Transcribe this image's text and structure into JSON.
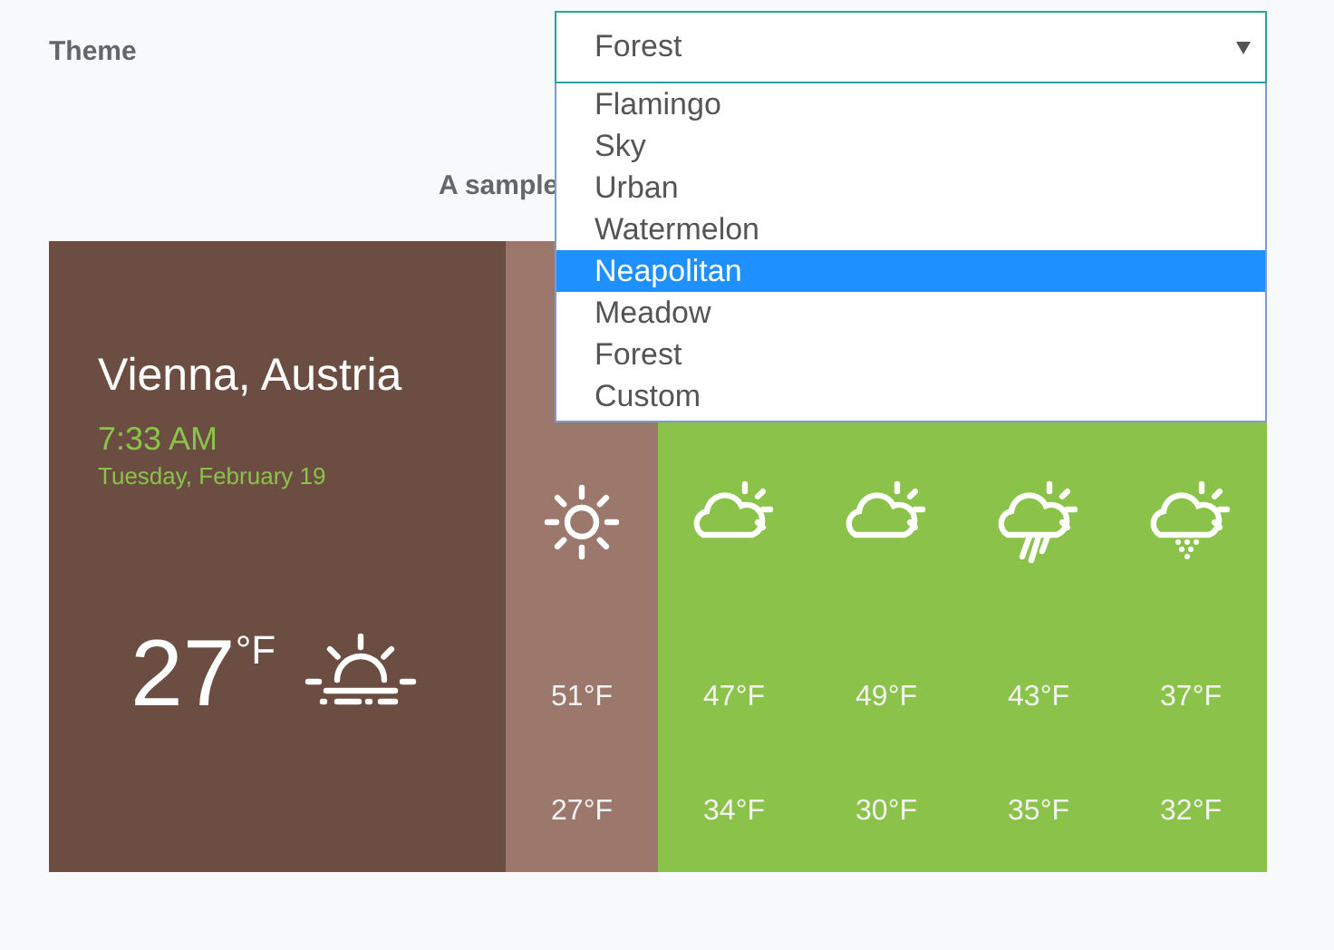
{
  "theme": {
    "label": "Theme",
    "value": "Forest",
    "expanded": true,
    "options": [
      {
        "label": "Flamingo",
        "highlighted": false
      },
      {
        "label": "Sky",
        "highlighted": false
      },
      {
        "label": "Urban",
        "highlighted": false
      },
      {
        "label": "Watermelon",
        "highlighted": false
      },
      {
        "label": "Neapolitan",
        "highlighted": true
      },
      {
        "label": "Meadow",
        "highlighted": false
      },
      {
        "label": "Forest",
        "highlighted": false
      },
      {
        "label": "Custom",
        "highlighted": false
      }
    ]
  },
  "caption": "A sample",
  "widget": {
    "city": "Vienna, Austria",
    "time": "7:33 AM",
    "date": "Tuesday, February 19",
    "temperature": "27",
    "unit": "°F",
    "current": {
      "kind": "sunrise"
    },
    "forecast": [
      {
        "kind": "sun",
        "high": "51°F",
        "low": "27°F",
        "selected": true
      },
      {
        "kind": "partly-cloudy",
        "high": "47°F",
        "low": "34°F",
        "selected": false
      },
      {
        "kind": "partly-cloudy",
        "high": "49°F",
        "low": "30°F",
        "selected": false
      },
      {
        "kind": "rain",
        "high": "43°F",
        "low": "35°F",
        "selected": false
      },
      {
        "kind": "snow",
        "high": "37°F",
        "low": "32°F",
        "selected": false
      }
    ]
  }
}
